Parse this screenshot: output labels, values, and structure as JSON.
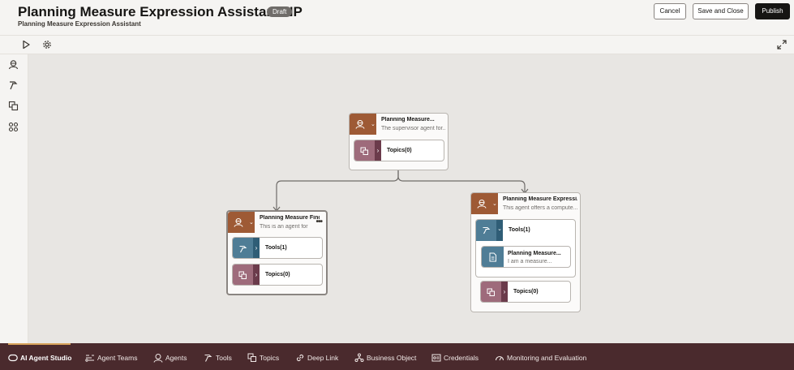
{
  "header": {
    "title": "Planning Measure Expression Assistant NP",
    "badge": "Draft",
    "subtitle": "Planning Measure Expression Assistant",
    "cancel_label": "Cancel",
    "save_close_label": "Save and Close",
    "publish_label": "Publish"
  },
  "toolbar": {
    "icons": [
      "play-icon",
      "gear-icon",
      "expand-icon"
    ]
  },
  "rail": {
    "icons": [
      "agent-icon",
      "tools-icon",
      "topics-icon",
      "agent-teams-icon"
    ]
  },
  "canvas": {
    "supervisor": {
      "name": "Planning Measure...",
      "description": "The supervisor agent for...",
      "topics": "Topics(0)"
    },
    "agent_left": {
      "name": "Planning Measure Find...",
      "description": "This is an agent for th",
      "tools": "Tools(1)",
      "topics": "Topics(0)"
    },
    "agent_right": {
      "name": "Planning Measure Expressi...",
      "description": "This agent offers a compute...",
      "tools": "Tools(1)",
      "tool_item_name": "Planning Measure...",
      "tool_item_desc": "I am a measure...",
      "topics": "Topics(0)"
    }
  },
  "bottom_nav": {
    "items": [
      {
        "label": "AI Agent Studio",
        "icon": "studio-icon"
      },
      {
        "label": "Agent Teams",
        "icon": "agent-teams-icon"
      },
      {
        "label": "Agents",
        "icon": "agent-icon"
      },
      {
        "label": "Tools",
        "icon": "tools-icon"
      },
      {
        "label": "Topics",
        "icon": "topics-icon"
      },
      {
        "label": "Deep Link",
        "icon": "link-icon"
      },
      {
        "label": "Business Object",
        "icon": "business-object-icon"
      },
      {
        "label": "Credentials",
        "icon": "credentials-icon"
      },
      {
        "label": "Monitoring and Evaluation",
        "icon": "monitoring-icon"
      }
    ]
  },
  "colors": {
    "agent": "#9e5a35",
    "tool": "#4f7d96",
    "topic": "#9e6b7b",
    "nav_bg": "#4a2a2d",
    "nav_accent": "#d8a35b"
  }
}
